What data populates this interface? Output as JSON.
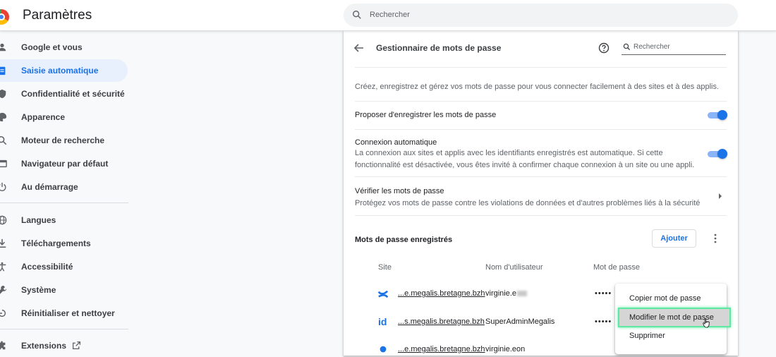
{
  "header": {
    "title": "Paramètres",
    "search_placeholder": "Rechercher"
  },
  "sidebar": {
    "items": [
      {
        "label": "Google et vous",
        "icon": "person-icon",
        "active": false
      },
      {
        "label": "Saisie automatique",
        "icon": "clipboard-icon",
        "active": true
      },
      {
        "label": "Confidentialité et sécurité",
        "icon": "shield-icon",
        "active": false
      },
      {
        "label": "Apparence",
        "icon": "palette-icon",
        "active": false
      },
      {
        "label": "Moteur de recherche",
        "icon": "search-icon",
        "active": false
      },
      {
        "label": "Navigateur par défaut",
        "icon": "browser-icon",
        "active": false
      },
      {
        "label": "Au démarrage",
        "icon": "power-icon",
        "active": false
      },
      {
        "label": "Langues",
        "icon": "globe-icon",
        "active": false
      },
      {
        "label": "Téléchargements",
        "icon": "download-icon",
        "active": false
      },
      {
        "label": "Accessibilité",
        "icon": "accessibility-icon",
        "active": false
      },
      {
        "label": "Système",
        "icon": "wrench-icon",
        "active": false
      },
      {
        "label": "Réinitialiser et nettoyer",
        "icon": "restore-icon",
        "active": false
      },
      {
        "label": "Extensions",
        "icon": "puzzle-icon",
        "active": false
      }
    ]
  },
  "main": {
    "title": "Gestionnaire de mots de passe",
    "search_placeholder": "Rechercher",
    "description": "Créez, enregistrez et gérez vos mots de passe pour vous connecter facilement à des sites et à des applis.",
    "offer_save": {
      "label": "Proposer d'enregistrer les mots de passe",
      "enabled": true
    },
    "auto_signin": {
      "label": "Connexion automatique",
      "sub_line1": "La connexion aux sites et applis avec les identifiants enregistrés est automatique. Si cette",
      "sub_line2": "fonctionnalité est désactivée, vous êtes invité à confirmer chaque connexion à un site ou une appli.",
      "enabled": true
    },
    "check": {
      "label": "Vérifier les mots de passe",
      "sub": "Protégez vos mots de passe contre les violations de données et d'autres problèmes liés à la sécurité"
    },
    "saved": {
      "title": "Mots de passe enregistrés",
      "add_label": "Ajouter",
      "columns": {
        "site": "Site",
        "user": "Nom d'utilisateur",
        "password": "Mot de passe"
      },
      "rows": [
        {
          "site": "...e.megalis.bretagne.bzh",
          "user": "virginie.e",
          "password": "•••••",
          "icon": "confluence-icon"
        },
        {
          "site": "...s.megalis.bretagne.bzh",
          "user": "SuperAdminMegalis",
          "password": "•••••",
          "icon": "id-icon"
        },
        {
          "site": "...e.megalis.bretagne.bzh",
          "user": "virginie.eon",
          "password": "",
          "icon": "site-icon"
        }
      ]
    }
  },
  "context_menu": {
    "items": [
      "Copier mot de passe",
      "Modifier le mot de passe",
      "Supprimer"
    ],
    "highlighted": 1
  },
  "colors": {
    "accent": "#1a73e8",
    "highlight_border": "#5ee8a1"
  }
}
